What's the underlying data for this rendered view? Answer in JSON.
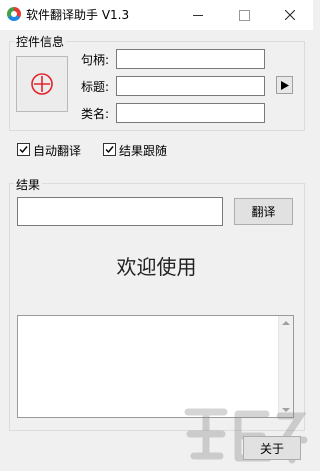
{
  "window": {
    "title": "软件翻译助手 V1.3",
    "icon": "app-logo-icon"
  },
  "control_info": {
    "group_label": "控件信息",
    "target_icon": "crosshair-icon",
    "target_color": "#e0262c",
    "fields": [
      {
        "label": "句柄:",
        "value": ""
      },
      {
        "label": "标题:",
        "value": ""
      },
      {
        "label": "类名:",
        "value": ""
      }
    ],
    "expand_icon": "play-arrow-icon"
  },
  "options": {
    "auto_translate": {
      "label": "自动翻译",
      "checked": true
    },
    "follow_result": {
      "label": "结果跟随",
      "checked": true
    }
  },
  "result": {
    "group_label": "结果",
    "input_value": "",
    "translate_button": "翻译",
    "welcome_text": "欢迎使用",
    "output_text": ""
  },
  "footer": {
    "about_button": "关于"
  }
}
